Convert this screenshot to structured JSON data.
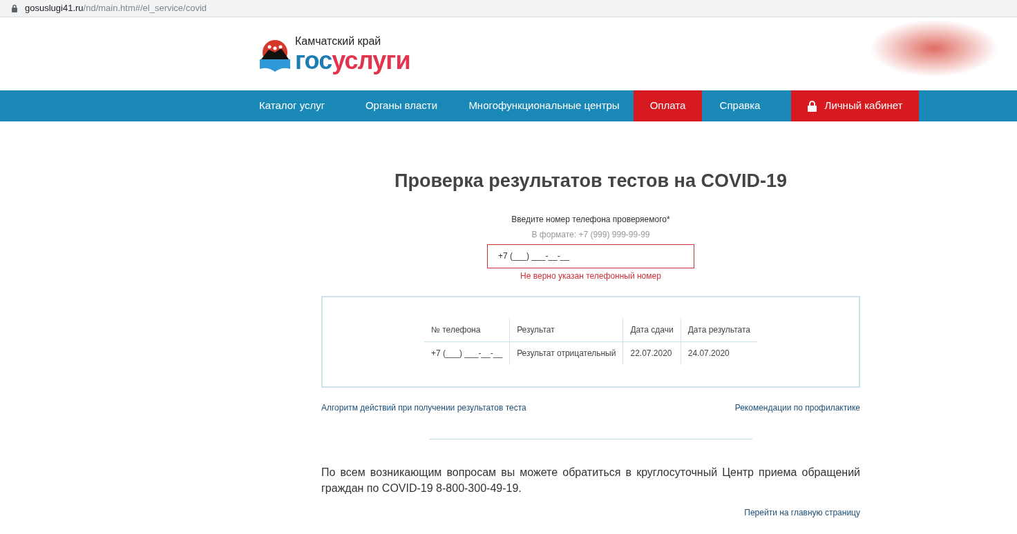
{
  "browser": {
    "url_host": "gosuslugi41.ru",
    "url_path": "/nd/main.htm#/el_service/covid"
  },
  "logo": {
    "region": "Камчатский край",
    "word_first": "гос",
    "word_second": "услуги"
  },
  "nav": [
    {
      "label": "Каталог услуг",
      "highlighted": false,
      "kind": "link"
    },
    {
      "label": "Органы власти",
      "highlighted": false,
      "kind": "link"
    },
    {
      "label": "Многофункциональные центры",
      "highlighted": false,
      "kind": "link"
    },
    {
      "label": "Оплата",
      "highlighted": true,
      "kind": "link"
    },
    {
      "label": "Справка",
      "highlighted": false,
      "kind": "link"
    },
    {
      "label": "Личный кабинет",
      "highlighted": true,
      "kind": "login"
    }
  ],
  "title": "Проверка результатов тестов на COVID-19",
  "phone_form": {
    "label": "Введите номер телефона проверяемого*",
    "hint": "В формате: +7 (999) 999-99-99",
    "value": "+7 (___) ___-__-__",
    "error": true,
    "error_text": "Не верно указан телефонный номер"
  },
  "table": {
    "columns": [
      "№ телефона",
      "Результат",
      "Дата сдачи",
      "Дата результата"
    ],
    "rows": [
      [
        "+7 (___) ___-__-__",
        "Результат отрицательный",
        "22.07.2020",
        "24.07.2020"
      ]
    ]
  },
  "links": {
    "left": "Алгоритм действий при получении результатов теста",
    "right": "Рекомендации по профилактике"
  },
  "contact_text": "По всем возникающим вопросам вы можете обратиться в круглосуточный Центр приема обращений граждан по COVID-19 8-800-300-49-19.",
  "home_link": "Перейти на главную страницу"
}
